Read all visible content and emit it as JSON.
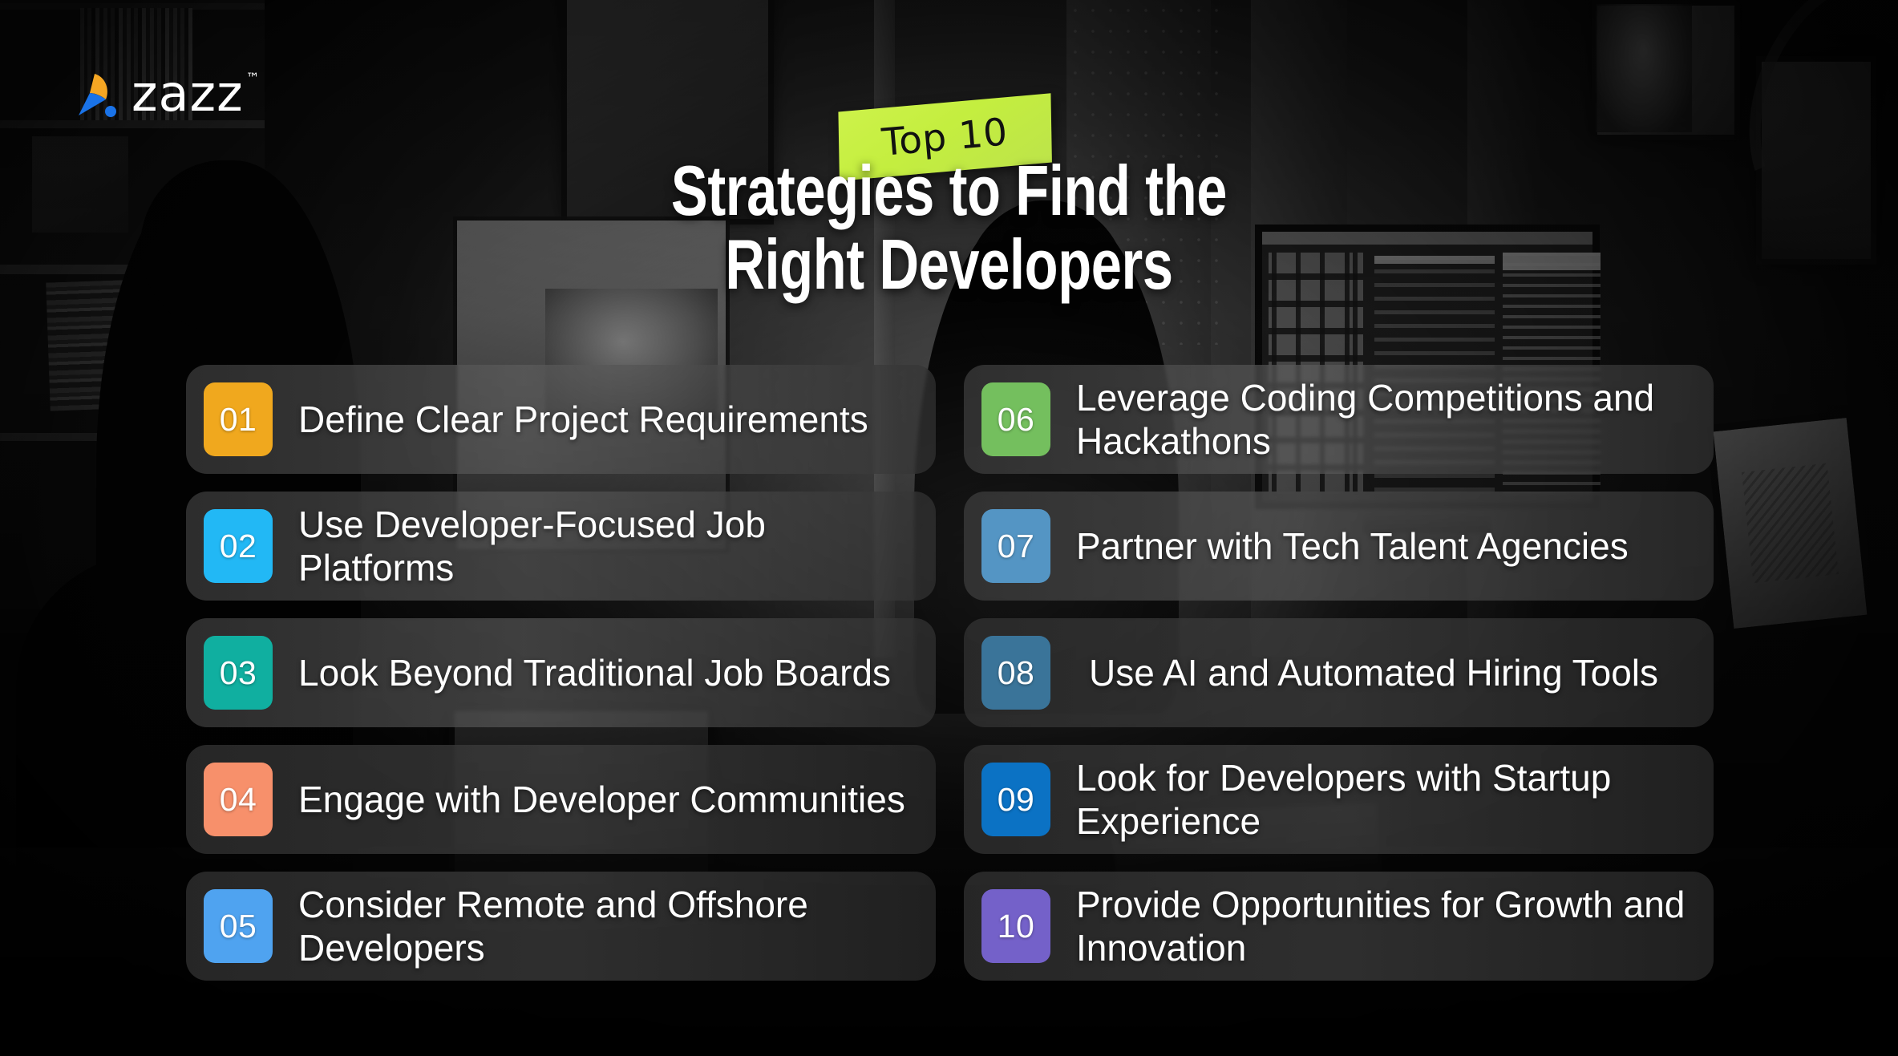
{
  "brand": {
    "logo_text": "zazz",
    "trademark": "™",
    "logo_colors": {
      "blue": "#1a73e8",
      "orange": "#f5a623"
    }
  },
  "title": {
    "sticker_label": "Top 10",
    "sticker_color": "#c8ef46",
    "line1": "Strategies to Find the",
    "line2": "Right Developers"
  },
  "list": {
    "left_column": [
      {
        "number": "01",
        "label": "Define Clear Project Requirements",
        "color": "#f0a81e"
      },
      {
        "number": "02",
        "label": "Use Developer-Focused Job Platforms",
        "color": "#22b8f5"
      },
      {
        "number": "03",
        "label": "Look Beyond Traditional Job Boards",
        "color": "#10afa0"
      },
      {
        "number": "04",
        "label": "Engage with Developer Communities",
        "color": "#f7906b"
      },
      {
        "number": "05",
        "label": "Consider Remote and Offshore Developers",
        "color": "#4fa3f0"
      }
    ],
    "right_column": [
      {
        "number": "06",
        "label": "Leverage Coding Competitions and Hackathons",
        "color": "#74bf5e"
      },
      {
        "number": "07",
        "label": "Partner with Tech Talent Agencies",
        "color": "#5495c4"
      },
      {
        "number": "08",
        "label": "Use AI and Automated Hiring Tools",
        "color": "#3a7499"
      },
      {
        "number": "09",
        "label": "Look for Developers with Startup Experience",
        "color": "#0b72c4"
      },
      {
        "number": "10",
        "label": "Provide Opportunities for Growth and Innovation",
        "color": "#7461c9"
      }
    ]
  }
}
